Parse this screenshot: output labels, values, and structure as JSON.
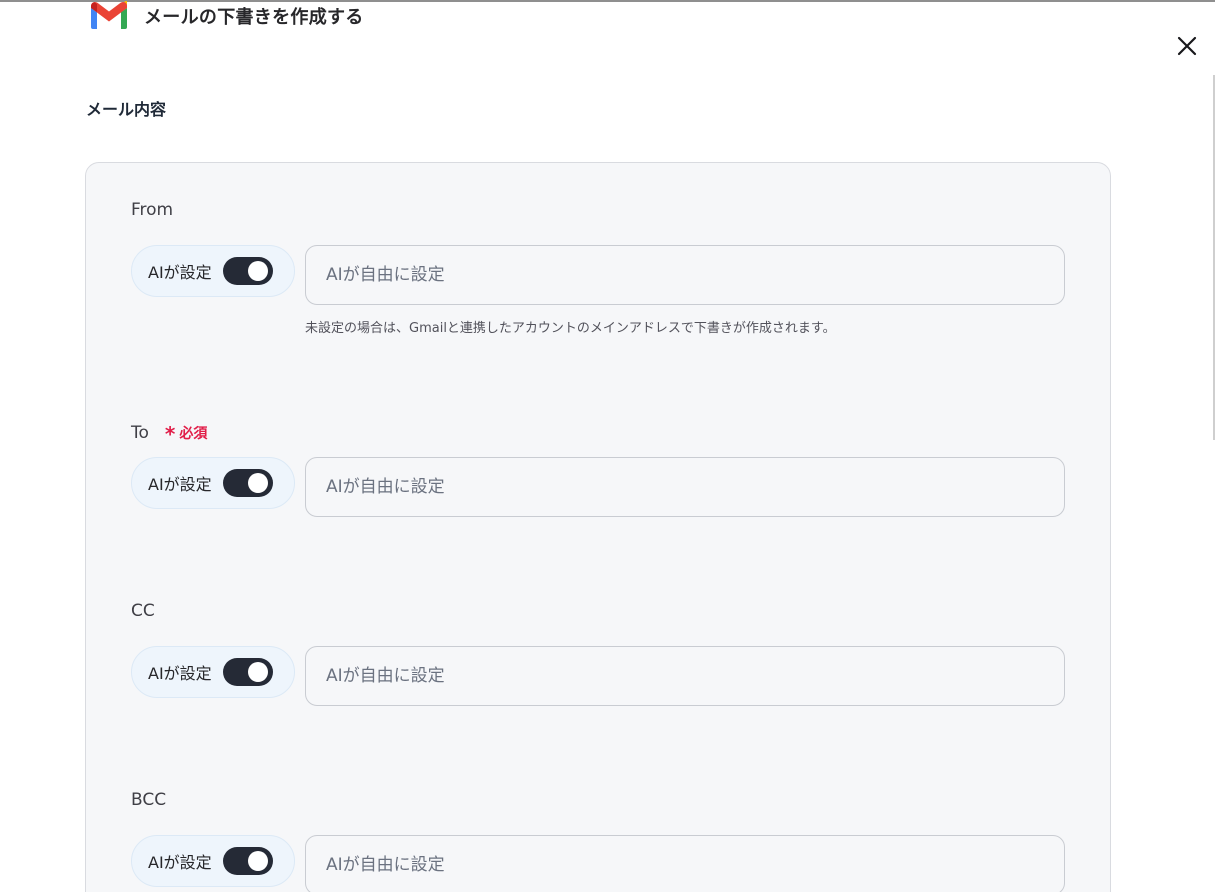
{
  "header": {
    "title": "メールの下書きを作成する",
    "icon": "gmail-icon"
  },
  "close": {
    "icon": "close-icon"
  },
  "section": {
    "title": "メール内容"
  },
  "fields": [
    {
      "label": "From",
      "ai_toggle_label": "AIが設定",
      "ai_toggle_on": true,
      "placeholder": "AIが自由に設定",
      "value": "",
      "hint": "未設定の場合は、Gmailと連携したアカウントのメインアドレスで下書きが作成されます。"
    },
    {
      "label": "To",
      "required_mark": "*",
      "required_label": "必須",
      "ai_toggle_label": "AIが設定",
      "ai_toggle_on": true,
      "placeholder": "AIが自由に設定",
      "value": ""
    },
    {
      "label": "CC",
      "ai_toggle_label": "AIが設定",
      "ai_toggle_on": true,
      "placeholder": "AIが自由に設定",
      "value": ""
    },
    {
      "label": "BCC",
      "ai_toggle_label": "AIが設定",
      "ai_toggle_on": true,
      "placeholder": "AIが自由に設定",
      "value": ""
    }
  ],
  "colors": {
    "required": "#e11d48",
    "toggle_on": "#252a36",
    "panel_bg": "#f6f7f9"
  }
}
